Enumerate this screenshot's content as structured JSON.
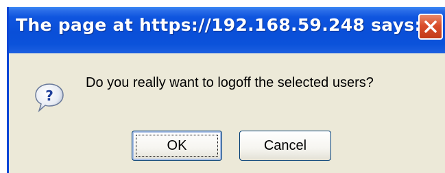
{
  "dialog": {
    "title": "The page at https://192.168.59.248 says:",
    "message": "Do you really want to logoff the selected users?",
    "icon": "question-icon",
    "buttons": {
      "ok_label": "OK",
      "cancel_label": "Cancel"
    },
    "close_icon": "close-icon"
  },
  "colors": {
    "titlebar": "#0a4fd8",
    "dialog_background": "#ece9d8",
    "close_button": "#d94d2b"
  }
}
